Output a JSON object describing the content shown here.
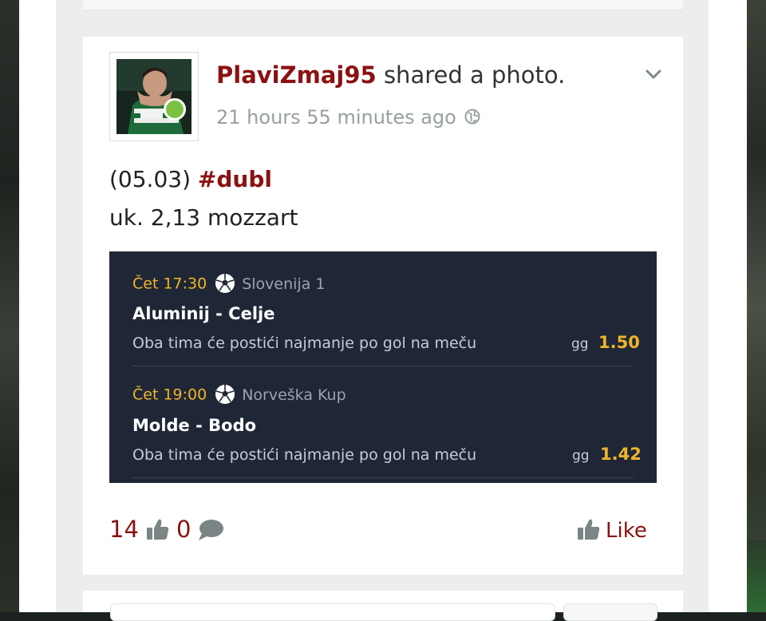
{
  "post": {
    "username": "PlaviZmaj95",
    "action": "shared a photo.",
    "timestamp": "21 hours 55 minutes ago",
    "text_line1_prefix": "(05.03)",
    "hashtag": "#dubl",
    "text_line2": "uk. 2,13 mozzart",
    "online_status_color": "#7bc142"
  },
  "ticket": {
    "matches": [
      {
        "time": "Čet 17:30",
        "league": "Slovenija 1",
        "teams": "Aluminij - Celje",
        "market": "Oba tima će postići najmanje po gol na meču",
        "odd_type": "gg",
        "odd": "1.50"
      },
      {
        "time": "Čet 19:00",
        "league": "Norveška Kup",
        "teams": "Molde - Bodo",
        "market": "Oba tima će postići najmanje po gol na meču",
        "odd_type": "gg",
        "odd": "1.42"
      }
    ],
    "icons": {
      "sport": "soccer-ball-icon"
    }
  },
  "footer": {
    "likes_count": "14",
    "comments_count": "0",
    "like_label": "Like"
  },
  "colors": {
    "brand_red": "#8b1111",
    "odd_yellow": "#f0b429",
    "ticket_bg": "#1f2736"
  }
}
